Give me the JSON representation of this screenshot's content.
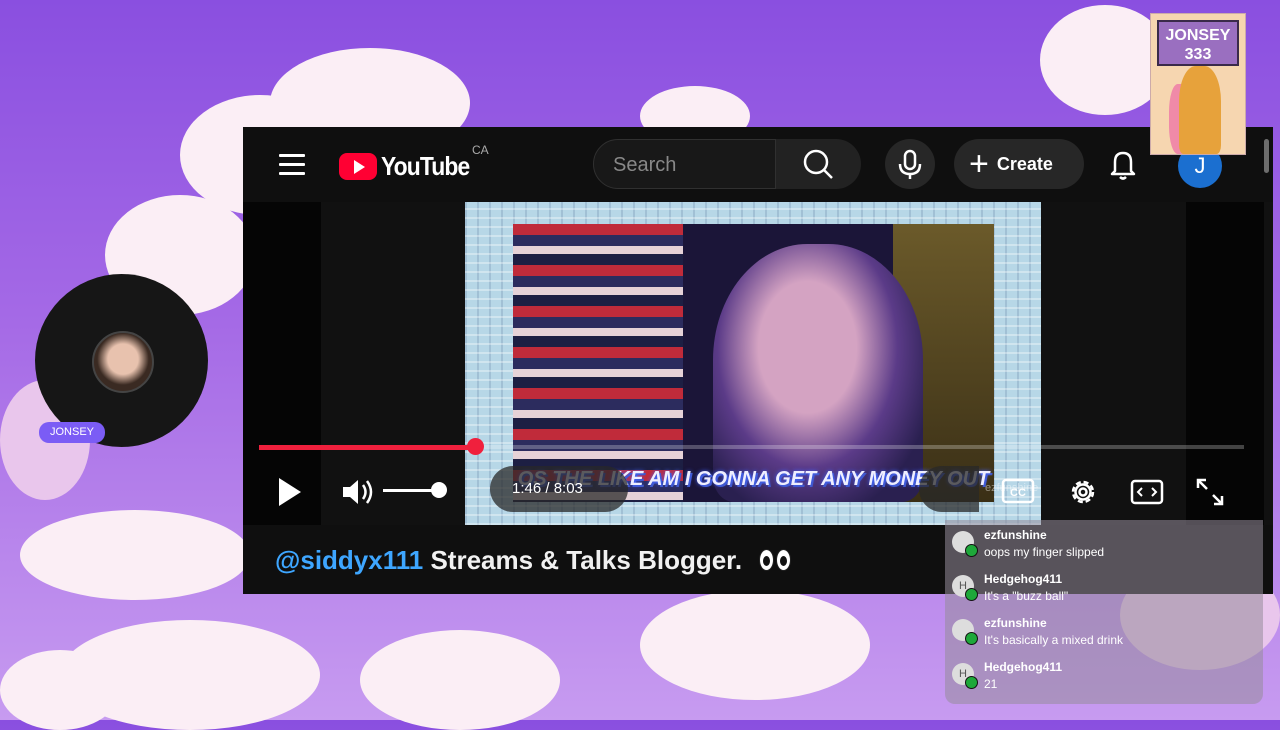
{
  "youtube": {
    "logo_text": "YouTube",
    "country": "CA",
    "search_placeholder": "Search",
    "create_label": "Create",
    "avatar_initial": "J",
    "player": {
      "current_time": "1:46",
      "duration": "8:03",
      "time_display": "1:46 / 8:03",
      "progress_fraction": 0.219,
      "volume_fraction": 1.0,
      "caption": "OS THE LIKE AM I GONNA GET ANY MONEY OUT"
    },
    "video_title_handle": "@siddyx111",
    "video_title_rest": " Streams & Talks Blogger."
  },
  "cam": {
    "label": "JONSEY"
  },
  "sticker": {
    "line1": "JONSEY",
    "line2": "333"
  },
  "chat": {
    "faint_top": "ezfunshine",
    "messages": [
      {
        "user": "ezfunshine",
        "text": "oops my finger slipped",
        "avatar": ""
      },
      {
        "user": "Hedgehog411",
        "text": "It's a \"buzz ball\"",
        "avatar": "H"
      },
      {
        "user": "ezfunshine",
        "text": "It's basically a mixed drink",
        "avatar": ""
      },
      {
        "user": "Hedgehog411",
        "text": "21",
        "avatar": "H"
      }
    ]
  },
  "colors": {
    "accent_red": "#f0203d",
    "link_blue": "#3ea6ff",
    "cam_label_bg": "#7b5cf5"
  }
}
